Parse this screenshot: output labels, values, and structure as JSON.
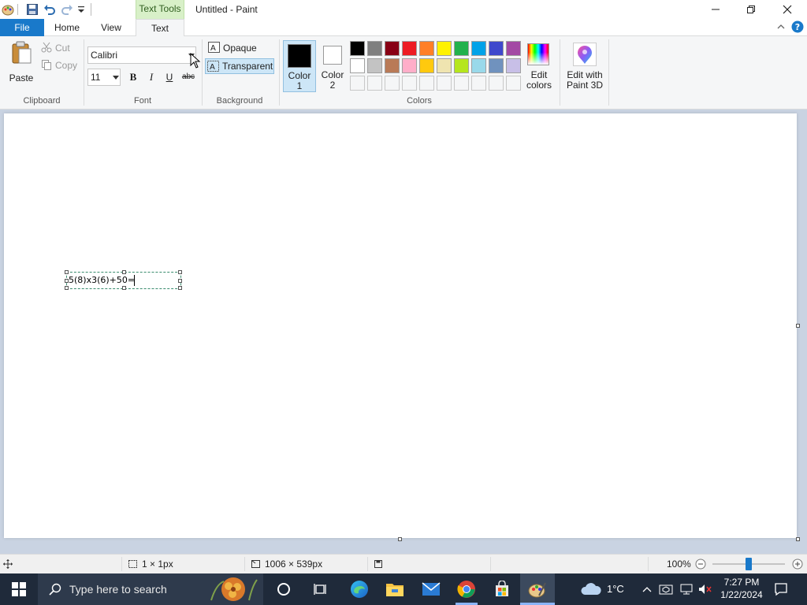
{
  "title_bar": {
    "context_tab": "Text Tools",
    "title": "Untitled - Paint"
  },
  "tabs": [
    {
      "label": "File"
    },
    {
      "label": "Home"
    },
    {
      "label": "View"
    },
    {
      "label": "Text"
    }
  ],
  "ribbon": {
    "clipboard": {
      "paste": "Paste",
      "cut": "Cut",
      "copy": "Copy",
      "group": "Clipboard"
    },
    "font": {
      "family": "Calibri",
      "size": "11",
      "bold": "B",
      "italic": "I",
      "underline": "U",
      "strike": "abc",
      "group": "Font"
    },
    "background": {
      "opaque": "Opaque",
      "transparent": "Transparent",
      "group": "Background"
    },
    "colors": {
      "color1_label": "Color\n1",
      "color2_label": "Color\n2",
      "edit_colors": "Edit\ncolors",
      "edit_paint3d": "Edit with\nPaint 3D",
      "group": "Colors",
      "color1": "#000000",
      "color2": "#ffffff",
      "row1": [
        "#000000",
        "#7f7f7f",
        "#880015",
        "#ed1c24",
        "#ff7f27",
        "#fff200",
        "#22b14c",
        "#00a2e8",
        "#3f48cc",
        "#a349a4"
      ],
      "row2": [
        "#ffffff",
        "#c3c3c3",
        "#b97a57",
        "#ffaec9",
        "#ffc90e",
        "#efe4b0",
        "#b5e61d",
        "#99d9ea",
        "#7092be",
        "#c8bfe7"
      ]
    }
  },
  "canvas": {
    "text_content": "5(8)x3(6)+50="
  },
  "status_bar": {
    "selection_size": "1 × 1px",
    "canvas_size": "1006 × 539px",
    "zoom": "100%"
  },
  "taskbar": {
    "search_placeholder": "Type here to search",
    "weather": "1°C",
    "time": "7:27 PM",
    "date": "1/22/2024"
  }
}
